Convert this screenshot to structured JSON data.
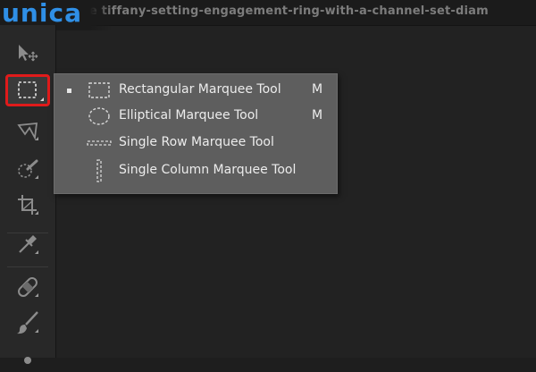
{
  "brand": {
    "logo_text": "unica"
  },
  "document": {
    "title": "the tiffany-setting-engagement-ring-with-a-channel-set-diam"
  },
  "toolbar": {
    "tools": [
      {
        "name": "move-tool",
        "icon": "move-icon"
      },
      {
        "name": "marquee-tool",
        "icon": "rect-marquee-icon",
        "selected": true
      },
      {
        "name": "lasso-tool",
        "icon": "lasso-icon"
      },
      {
        "name": "quick-selection-tool",
        "icon": "quick-selection-icon"
      },
      {
        "name": "crop-tool",
        "icon": "crop-icon"
      },
      {
        "name": "eyedropper-tool",
        "icon": "eyedropper-icon"
      },
      {
        "name": "healing-brush-tool",
        "icon": "bandage-icon"
      },
      {
        "name": "brush-tool",
        "icon": "brush-icon"
      }
    ]
  },
  "flyout": {
    "items": [
      {
        "label": "Rectangular Marquee Tool",
        "shortcut": "M",
        "icon": "rect-marquee-icon",
        "active": true
      },
      {
        "label": "Elliptical Marquee Tool",
        "shortcut": "M",
        "icon": "ellipse-marquee-icon",
        "active": false
      },
      {
        "label": "Single Row Marquee Tool",
        "shortcut": "",
        "icon": "single-row-marquee-icon",
        "active": false
      },
      {
        "label": "Single Column Marquee Tool",
        "shortcut": "",
        "icon": "single-column-marquee-icon",
        "active": false
      }
    ]
  },
  "colors": {
    "highlight_border": "#e01b1b",
    "logo_blue": "#2f8fe6",
    "menu_bg": "#5e5e5e"
  }
}
